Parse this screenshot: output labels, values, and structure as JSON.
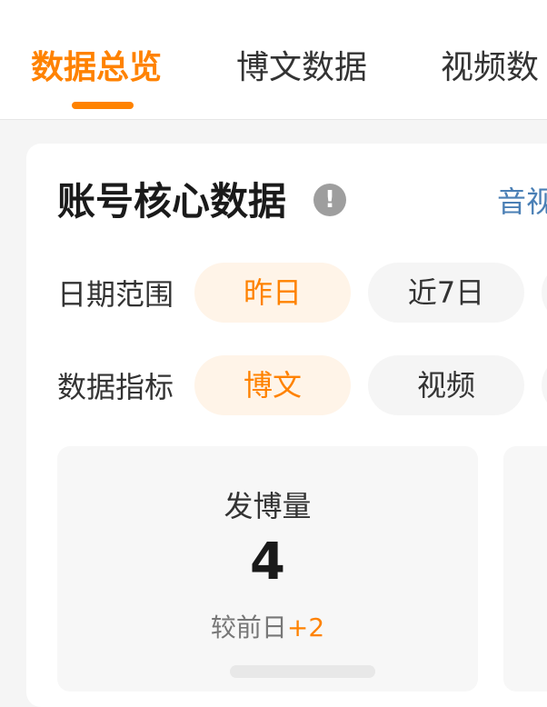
{
  "tabs": [
    {
      "label": "数据总览",
      "active": true
    },
    {
      "label": "博文数据",
      "active": false
    },
    {
      "label": "视频数",
      "active": false
    }
  ],
  "card": {
    "title": "账号核心数据",
    "info_icon": "info-icon",
    "side_link": "音视"
  },
  "date_range": {
    "label": "日期范围",
    "options": [
      "昨日",
      "近7日"
    ],
    "selected": "昨日"
  },
  "metric": {
    "label": "数据指标",
    "options": [
      "博文",
      "视频"
    ],
    "selected": "博文"
  },
  "stat": {
    "label": "发博量",
    "value": "4",
    "compare_prefix": "较前日",
    "compare_delta": "+2"
  },
  "colors": {
    "accent": "#ff8200",
    "accent_bg": "#fff4e8",
    "link": "#4a7fb5"
  }
}
